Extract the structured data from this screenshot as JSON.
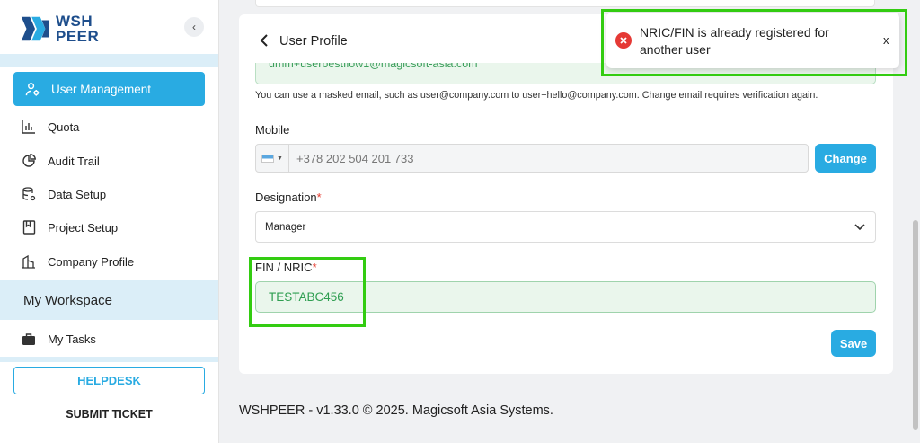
{
  "sidebar": {
    "logo_line1": "WSH",
    "logo_line2": "PEER",
    "collapse_icon": "chevron-left-icon",
    "items": [
      {
        "label": "User Management",
        "icon": "user-gear-icon",
        "active": true
      },
      {
        "label": "Quota",
        "icon": "bar-chart-icon"
      },
      {
        "label": "Audit Trail",
        "icon": "pie-chart-icon"
      },
      {
        "label": "Data Setup",
        "icon": "database-icon"
      },
      {
        "label": "Project Setup",
        "icon": "book-icon"
      },
      {
        "label": "Company Profile",
        "icon": "buildings-icon"
      }
    ],
    "workspace_label": "My Workspace",
    "my_tasks": {
      "label": "My Tasks",
      "icon": "briefcase-icon"
    },
    "helpdesk_label": "HELPDESK",
    "submit_ticket_label": "SUBMIT TICKET"
  },
  "header": {
    "title": "User Profile"
  },
  "form": {
    "email_value": "umm+userbestflow1@magicsoft-asia.com",
    "email_hint": "You can use a masked email, such as user@company.com to user+hello@company.com. Change email requires verification again.",
    "mobile_label": "Mobile",
    "mobile_value": "+378 202 504 201 733",
    "change_label": "Change",
    "designation_label": "Designation",
    "designation_value": "Manager",
    "fin_label": "FIN / NRIC",
    "fin_value": "TESTABC456",
    "required_mark": "*",
    "save_label": "Save"
  },
  "toast": {
    "message": "NRIC/FIN is already registered for another user",
    "close_label": "x",
    "icon": "error-circle-icon"
  },
  "footer": {
    "text": "WSHPEER - v1.33.0 © 2025. Magicsoft Asia Systems."
  },
  "colors": {
    "accent": "#29abe2",
    "success": "#2f9e51",
    "error": "#e53935",
    "highlight": "#33cc11"
  }
}
